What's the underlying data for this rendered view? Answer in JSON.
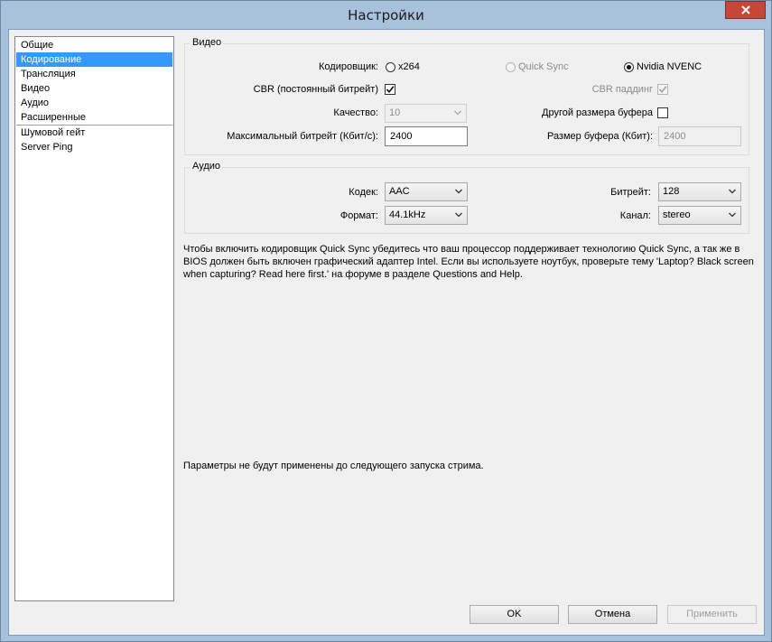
{
  "window": {
    "title": "Настройки"
  },
  "nav": {
    "items": [
      "Общие",
      "Кодирование",
      "Трансляция",
      "Видео",
      "Аудио",
      "Расширенные"
    ],
    "extra_items": [
      "Шумовой гейт",
      "Server Ping"
    ],
    "selected_index": 1
  },
  "video": {
    "group_label": "Видео",
    "encoder_label": "Кодировщик:",
    "encoders": [
      "x264",
      "Quick Sync",
      "Nvidia NVENC"
    ],
    "selected_encoder": "Nvidia NVENC",
    "cbr_label": "CBR (постоянный битрейт)",
    "cbr_checked": true,
    "cbr_padding_label": "CBR паддинг",
    "cbr_padding_checked": true,
    "quality_label": "Качество:",
    "quality_value": "10",
    "custom_buffer_label": "Другой размера буфера",
    "custom_buffer_checked": false,
    "max_bitrate_label": "Максимальный битрейт (Кбит/с):",
    "max_bitrate_value": "2400",
    "buffer_size_label": "Размер буфера (Кбит):",
    "buffer_size_value": "2400"
  },
  "audio": {
    "group_label": "Аудио",
    "codec_label": "Кодек:",
    "codec_value": "AAC",
    "bitrate_label": "Битрейт:",
    "bitrate_value": "128",
    "format_label": "Формат:",
    "format_value": "44.1kHz",
    "channel_label": "Канал:",
    "channel_value": "stereo"
  },
  "info_text": "Чтобы включить кодировщик Quick Sync убедитесь что ваш процессор поддерживает технологию Quick Sync, а так же в BIOS должен быть включен графический адаптер Intel. Если вы используете ноутбук, проверьте тему 'Laptop? Black screen when capturing? Read here first.' на форуме в разделе Questions and Help.",
  "notice_text": "Параметры не будут применены до следующего запуска стрима.",
  "buttons": {
    "ok": "OK",
    "cancel": "Отмена",
    "apply": "Применить"
  },
  "colors": {
    "selection": "#3399ff",
    "close": "#c7463a",
    "frame": "#a8c1db"
  },
  "icons": {
    "close": "close-icon",
    "check": "checkmark-icon",
    "dropdown": "chevron-down-icon"
  }
}
